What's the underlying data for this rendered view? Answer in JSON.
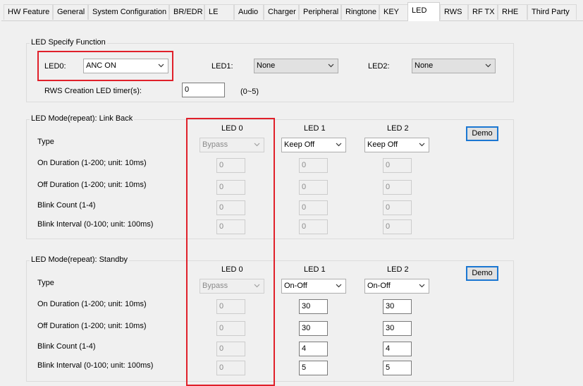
{
  "tabs": [
    {
      "label": "HW Feature"
    },
    {
      "label": "General"
    },
    {
      "label": "System Configuration"
    },
    {
      "label": "BR/EDR"
    },
    {
      "label": "LE"
    },
    {
      "label": "Audio"
    },
    {
      "label": "Charger"
    },
    {
      "label": "Peripheral"
    },
    {
      "label": "Ringtone"
    },
    {
      "label": "KEY"
    },
    {
      "label": "LED"
    },
    {
      "label": "RWS"
    },
    {
      "label": "RF TX"
    },
    {
      "label": "RHE"
    },
    {
      "label": "Third Party"
    }
  ],
  "active_tab": "LED",
  "specify": {
    "title": "LED Specify Function",
    "led0_label": "LED0:",
    "led0_value": "ANC ON",
    "led1_label": "LED1:",
    "led1_value": "None",
    "led2_label": "LED2:",
    "led2_value": "None",
    "rws_timer_label": "RWS Creation LED timer(s):",
    "rws_timer_value": "0",
    "rws_timer_range": "(0~5)"
  },
  "link_back": {
    "title": "LED Mode(repeat): Link Back",
    "demo_label": "Demo",
    "col_headers": [
      "LED 0",
      "LED 1",
      "LED 2"
    ],
    "row_labels": [
      "Type",
      "On Duration (1-200; unit: 10ms)",
      "Off Duration (1-200; unit: 10ms)",
      "Blink Count  (1-4)",
      "Blink Interval (0-100; unit: 100ms)"
    ],
    "type_values": [
      "Bypass",
      "Keep Off",
      "Keep Off"
    ],
    "led0_values": [
      "0",
      "0",
      "0",
      "0"
    ],
    "led1_values": [
      "0",
      "0",
      "0",
      "0"
    ],
    "led2_values": [
      "0",
      "0",
      "0",
      "0"
    ]
  },
  "standby": {
    "title": "LED Mode(repeat): Standby",
    "demo_label": "Demo",
    "col_headers": [
      "LED 0",
      "LED 1",
      "LED 2"
    ],
    "row_labels": [
      "Type",
      "On Duration (1-200; unit: 10ms)",
      "Off Duration (1-200; unit: 10ms)",
      "Blink Count  (1-4)",
      "Blink Interval (0-100; unit: 100ms)"
    ],
    "type_values": [
      "Bypass",
      "On-Off",
      "On-Off"
    ],
    "led0_values": [
      "0",
      "0",
      "0",
      "0"
    ],
    "led1_values": [
      "30",
      "30",
      "4",
      "5"
    ],
    "led2_values": [
      "30",
      "30",
      "4",
      "5"
    ]
  },
  "colors": {
    "highlight_box": "#e0202a",
    "focus_border": "#1b77d2"
  }
}
